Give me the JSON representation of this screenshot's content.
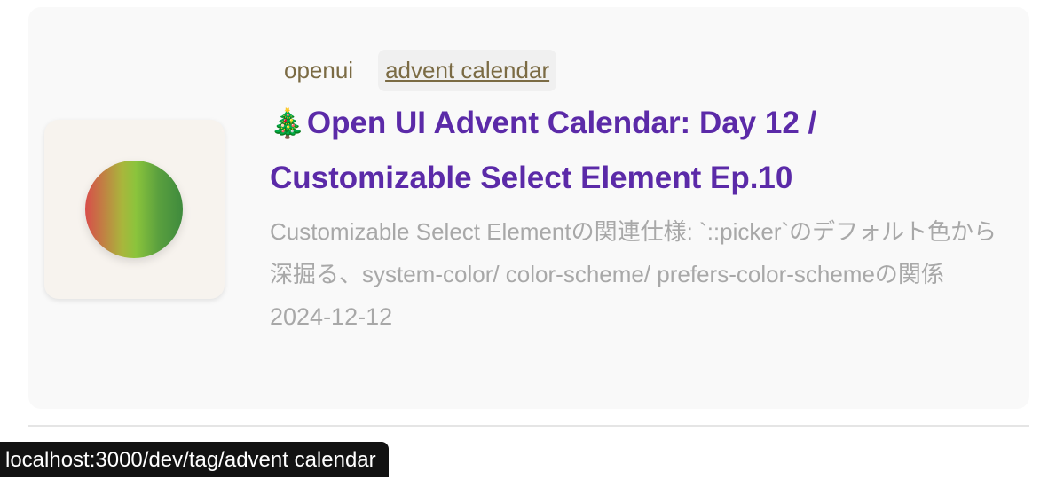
{
  "card": {
    "tags": [
      {
        "label": "openui",
        "active": false
      },
      {
        "label": "advent calendar",
        "active": true
      }
    ],
    "title_emoji": "🎄",
    "title": "Open UI Advent Calendar: Day 12 / Customizable Select Element Ep.10",
    "description": "Customizable Select Elementの関連仕様: `::picker`のデフォルト色から深掘る、system-color/ color-scheme/ prefers-color-schemeの関係",
    "date": "2024-12-12",
    "thumbnail_icon": "gradient-circle-icon"
  },
  "status_bar": {
    "url": "localhost:3000/dev/tag/advent calendar"
  },
  "colors": {
    "title": "#5b2aa8",
    "tag": "#7b6b44",
    "muted_text": "#a8a8a8",
    "card_bg": "#f9f9f9"
  }
}
